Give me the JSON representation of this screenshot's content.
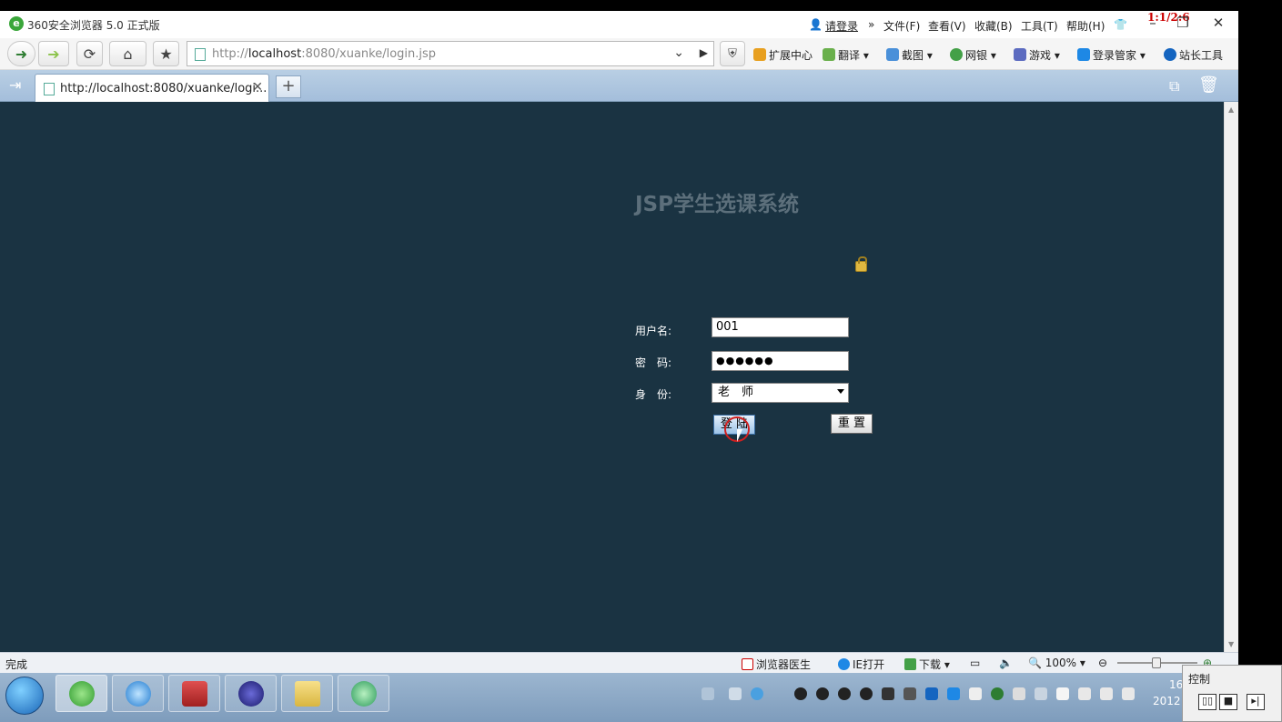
{
  "browser": {
    "title": "360安全浏览器 5.0 正式版",
    "counter": "1:1/2:6",
    "menu": {
      "login": "请登录",
      "file": "文件(F)",
      "view": "查看(V)",
      "favorites": "收藏(B)",
      "tools": "工具(T)",
      "help": "帮助(H)"
    },
    "address": {
      "host": "localhost",
      "prefix": "http://",
      "suffix": ":8080/xuanke/login.jsp"
    },
    "toolbar": {
      "extensions": "扩展中心",
      "translate": "翻译",
      "screenshot": "截图",
      "bank": "网银",
      "games": "游戏",
      "login_manager": "登录管家",
      "webmaster": "站长工具"
    },
    "tab": {
      "title": "http://localhost:8080/xuanke/logi..."
    }
  },
  "page": {
    "title": "JSP学生选课系统",
    "username_label": "用户名:",
    "username_value": "001",
    "password_label": "密　码:",
    "password_value": "●●●●●●",
    "role_label": "身　份:",
    "role_value": "老　师",
    "login_button": "登 陆",
    "reset_button": "重 置"
  },
  "statusbar": {
    "status": "完成",
    "doctor": "浏览器医生",
    "ie_open": "IE打开",
    "download": "下载",
    "zoom": "100%"
  },
  "taskbar": {
    "clock_time": "16",
    "clock_year": "2012"
  },
  "control_panel": {
    "label": "控制"
  }
}
